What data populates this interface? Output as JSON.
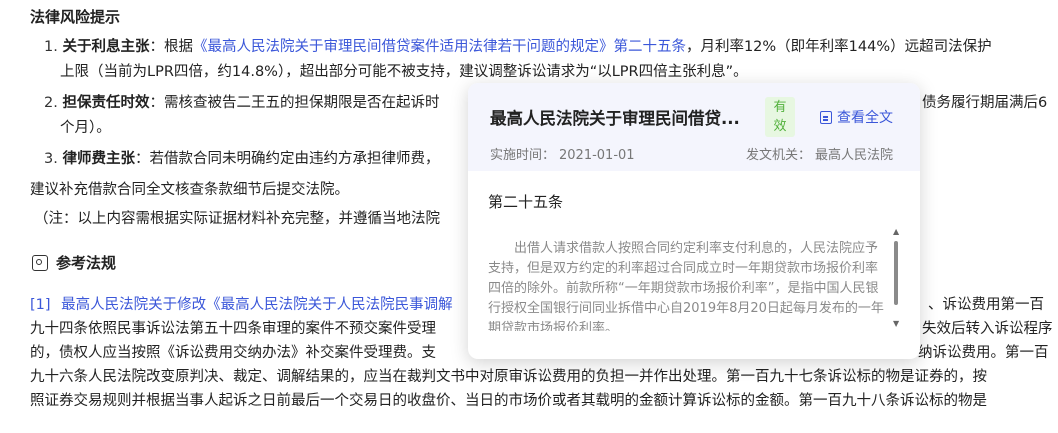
{
  "doc": {
    "heading": "法律风险提示",
    "items": [
      {
        "num": "1.",
        "title": "关于利息主张",
        "pre": "：根据",
        "link": "《最高人民法院关于审理民间借贷案件适用法律若干问题的规定》第二十五条",
        "post": "，月利率12%（即年利率144%）远超司法保护",
        "line2": "上限（当前为LPR四倍，约14.8%），超出部分可能不被支持，建议调整诉讼请求为“以LPR四倍主张利息”。"
      },
      {
        "num": "2.",
        "title": "担保责任时效",
        "text": "：需核查被告二王五的担保期限是否在起诉时",
        "tail": "债务履行期届满后6",
        "line2": "个月）。"
      },
      {
        "num": "3.",
        "title": "律师费主张",
        "text": "：若借款合同未明确约定由违约方承担律师费，"
      }
    ],
    "advice": "建议补充借款合同全文核查条款细节后提交法院。",
    "note": "（注：以上内容需根据实际证据材料补充完整，并遵循当地法院",
    "ref_heading": "参考法规",
    "refs": {
      "idx": "[1]",
      "link": "最高人民法院关于修改《最高人民法院关于人民法院民事调解",
      "l1_tail": "、诉讼费用第一百",
      "l2": "九十四条依照民事诉讼法第五十四条审理的案件不预交案件受理",
      "l2_tail": "失效后转入诉讼程序",
      "l3": "的，债权人应当按照《诉讼费用交纳办法》补交案件受理费。支",
      "l3_tail": "纳诉讼费用。第一百",
      "l4": "九十六条人民法院改变原判决、裁定、调解结果的，应当在裁判文书中对原审诉讼费用的负担一并作出处理。第一百九十七条诉讼标的物是证券的，按",
      "l5": "照证券交易规则并根据当事人起诉之日前最后一个交易日的收盘价、当日的市场价或者其载明的金额计算诉讼标的金额。第一百九十八条诉讼标的物是"
    }
  },
  "popover": {
    "title": "最高人民法院关于审理民间借贷...",
    "badge": "有效",
    "view_all": "查看全文",
    "effective_label": "实施时间：",
    "effective_date": "2021-01-01",
    "issuer_label": "发文机关：",
    "issuer": "最高人民法院",
    "article": "第二十五条",
    "body": "出借人请求借款人按照合同约定利率支付利息的，人民法院应予支持，但是双方约定的利率超过合同成立时一年期贷款市场报价利率四倍的除外。前款所称“一年期贷款市场报价利率”，是指中国人民银行授权全国银行间同业拆借中心自2019年8月20日起每月发布的一年期贷款市场报价利率。"
  }
}
